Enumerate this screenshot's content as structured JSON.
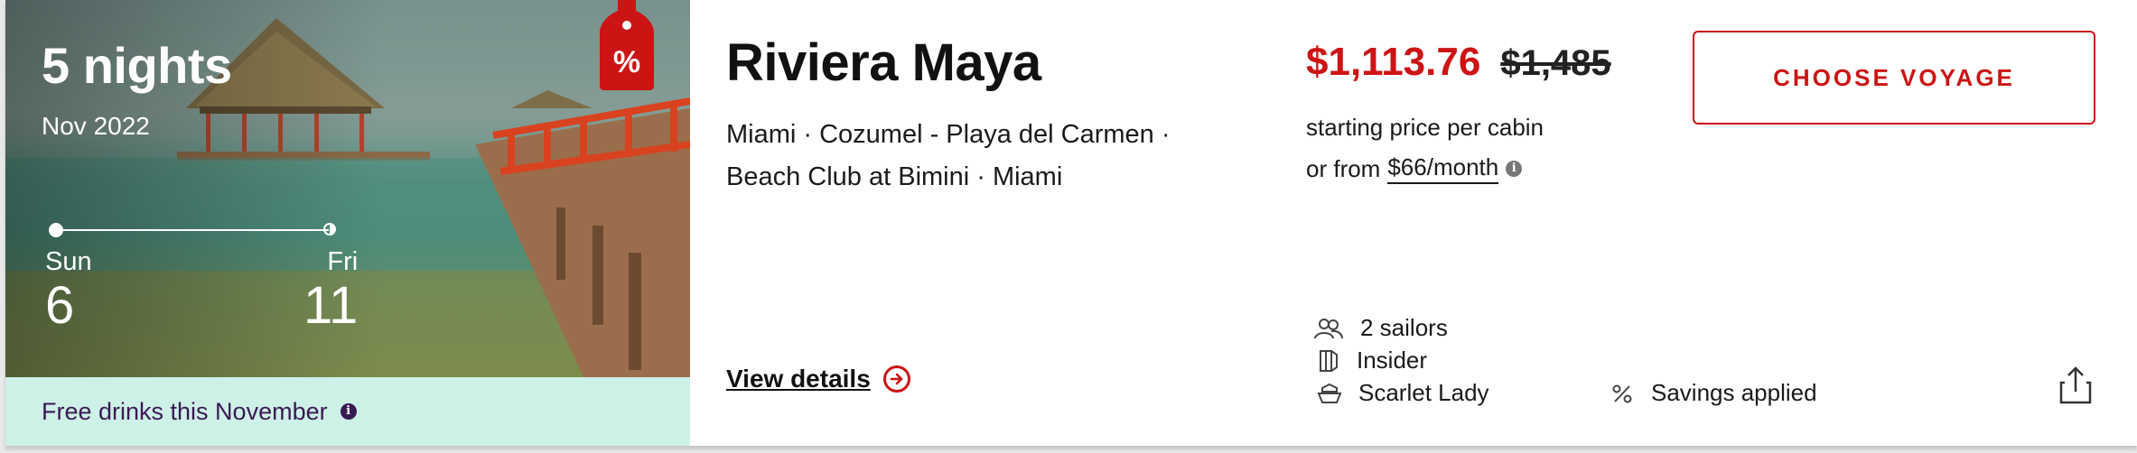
{
  "card": {
    "nights": "5 nights",
    "month": "Nov 2022",
    "start_day": {
      "name": "Sun",
      "num": "6"
    },
    "end_day": {
      "name": "Fri",
      "num": "11"
    },
    "sale_badge": "%",
    "promo": "Free drinks this November",
    "promo_info_icon": "info-icon",
    "title": "Riviera Maya",
    "route": "Miami · Cozumel - Playa del Carmen · Beach Club at Bimini · Miami",
    "view_details": "View details",
    "price": "$1,113.76",
    "old_price": "$1,485",
    "price_note": "starting price per cabin",
    "monthly_prefix": "or from",
    "monthly_link": "$66/month",
    "choose_button": "CHOOSE VOYAGE",
    "sailors": "2 sailors",
    "cabin_type": "Insider",
    "ship": "Scarlet Lady",
    "savings": "Savings applied"
  },
  "colors": {
    "accent": "#cc1414",
    "promo_bg": "#cdf0e7",
    "promo_text": "#3a1a52"
  },
  "icons": [
    "sale-tag-icon",
    "info-icon",
    "arrow-right-circle-icon",
    "sailors-icon",
    "cabin-icon",
    "ship-icon",
    "percent-icon",
    "share-icon"
  ]
}
